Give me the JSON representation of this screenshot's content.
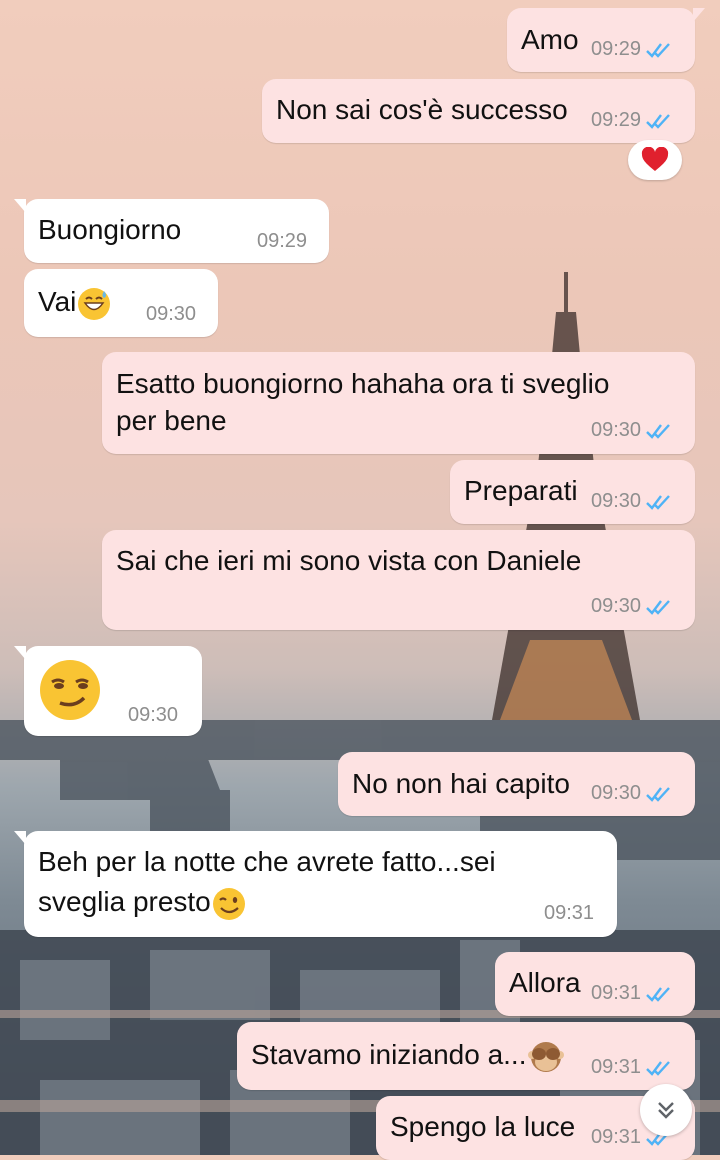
{
  "messages": [
    {
      "text": "Amo",
      "time": "09:29"
    },
    {
      "text": "Non sai cos'è successo",
      "time": "09:29"
    },
    {
      "text": "Buongiorno",
      "time": "09:29"
    },
    {
      "text": "Vai",
      "time": "09:30"
    },
    {
      "line1": "Esatto buongiorno hahaha ora ti sveglio",
      "line2": "per bene",
      "time": "09:30"
    },
    {
      "text": "Preparati",
      "time": "09:30"
    },
    {
      "text": "Sai che ieri mi sono vista con Daniele",
      "time": "09:30"
    },
    {
      "text": "",
      "time": "09:30"
    },
    {
      "text": "No non hai capito",
      "time": "09:30"
    },
    {
      "line1": "Beh per la notte che avrete fatto...sei",
      "line2": "sveglia presto",
      "time": "09:31"
    },
    {
      "text": "Allora",
      "time": "09:31"
    },
    {
      "text": "Stavamo iniziando a...",
      "time": "09:31"
    },
    {
      "text": "Spengo la luce",
      "time": "09:31"
    }
  ],
  "reaction": {
    "emoji_icon": "red-heart-icon"
  },
  "icons": {
    "read_receipt": "double-check-icon",
    "scroll_down": "double-chevron-down-icon"
  },
  "colors": {
    "outgoing_bubble": "#fde2e2",
    "incoming_bubble": "#ffffff",
    "read_check": "#4fb3f6",
    "timestamp": "#8e8e8e"
  }
}
